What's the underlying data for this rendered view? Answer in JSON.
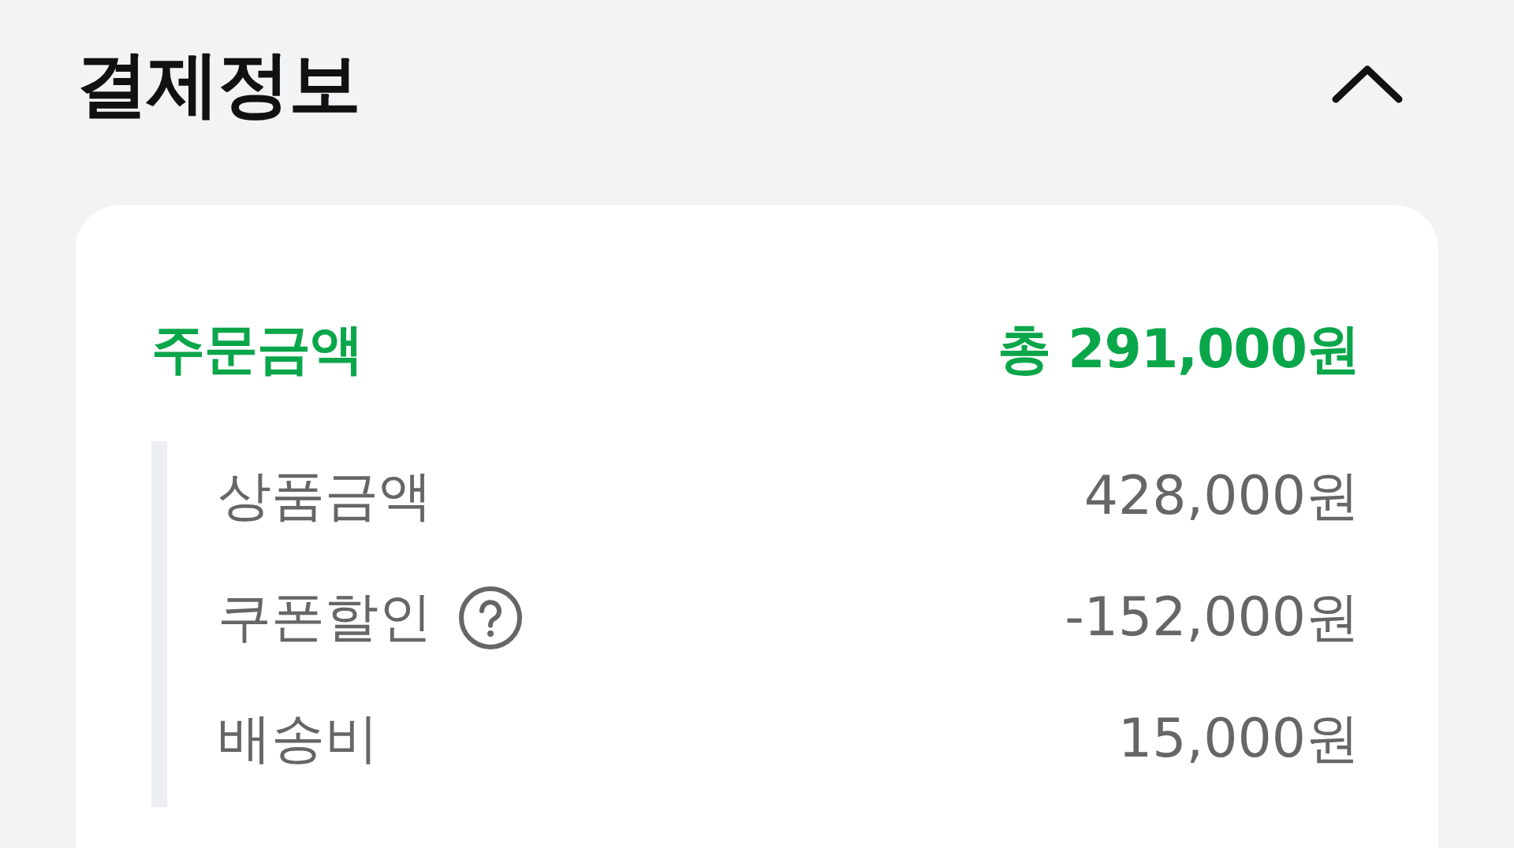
{
  "header": {
    "title": "결제정보",
    "expanded": true
  },
  "summary": {
    "label": "주문금액",
    "amount": "총 291,000원"
  },
  "items": [
    {
      "label": "상품금액",
      "value": "428,000원",
      "kind": "plain"
    },
    {
      "label": "쿠폰할인",
      "value": "-152,000원",
      "kind": "info"
    },
    {
      "label": "배송비",
      "value": "15,000원",
      "kind": "plain"
    }
  ]
}
